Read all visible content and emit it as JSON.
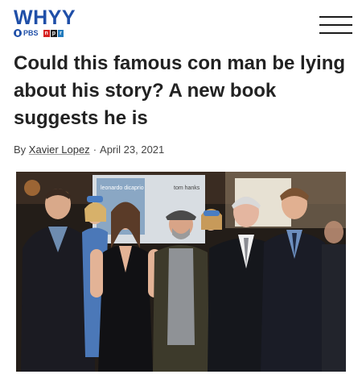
{
  "site": {
    "logo_text": "WHYY",
    "partner_pbs": "PBS",
    "partner_npr": [
      "n",
      "p",
      "r"
    ]
  },
  "header": {
    "menu_icon": "hamburger-menu-icon"
  },
  "article": {
    "title": "Could this famous con man be lying about his story? A new book suggests he is",
    "by_label": "By",
    "author": "Xavier Lopez",
    "separator": "·",
    "date": "April 23, 2021"
  },
  "photo": {
    "backdrop_text_1": "leonardo dicaprio",
    "backdrop_text_2": "tom hanks"
  }
}
